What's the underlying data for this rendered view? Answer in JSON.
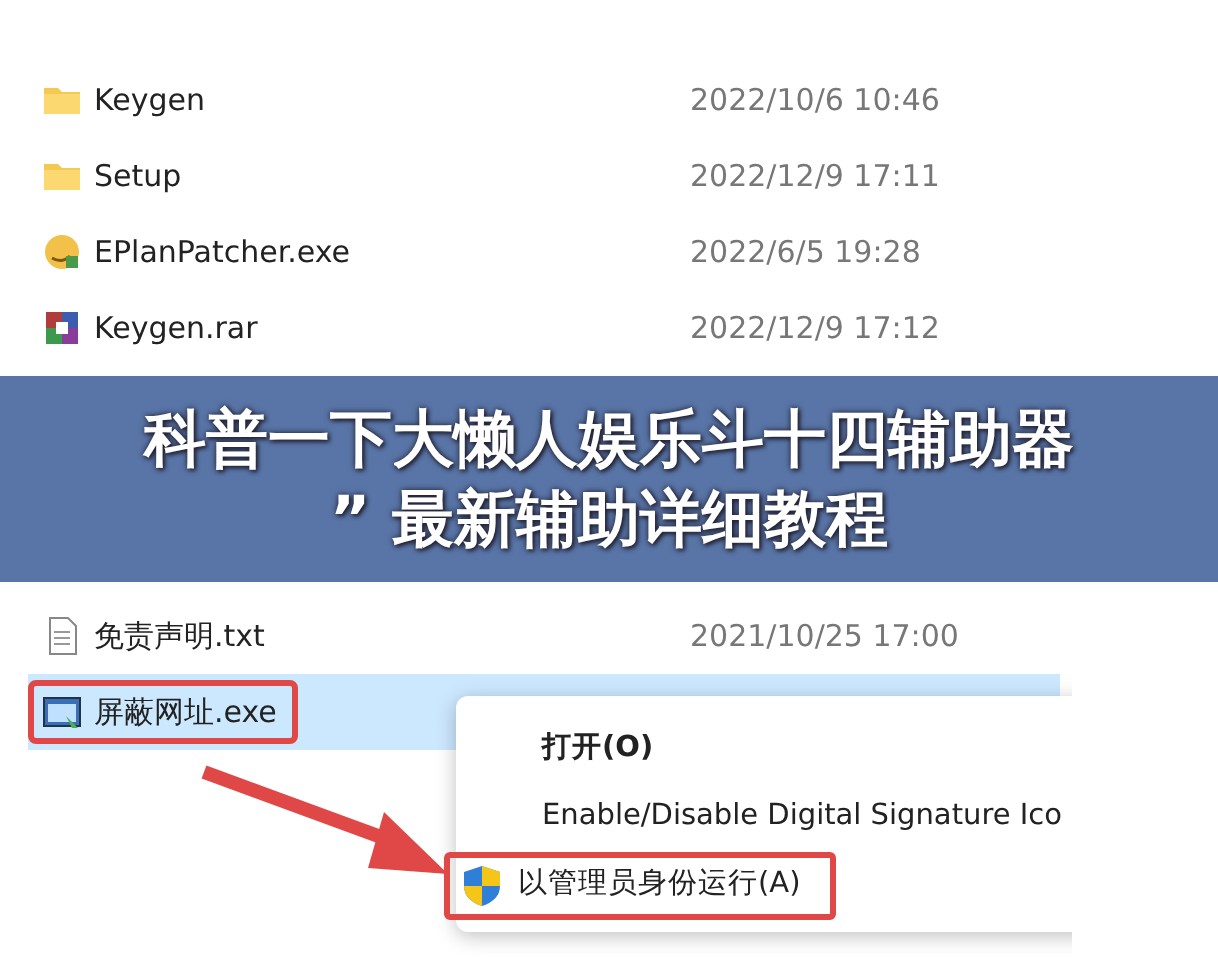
{
  "files": [
    {
      "name": "Keygen",
      "modified": "2022/10/6 10:46",
      "kind": "folder",
      "selected": false,
      "annotated": false
    },
    {
      "name": "Setup",
      "modified": "2022/12/9 17:11",
      "kind": "folder",
      "selected": false,
      "annotated": false
    },
    {
      "name": "EPlanPatcher.exe",
      "modified": "2022/6/5 19:28",
      "kind": "patcher",
      "selected": false,
      "annotated": false
    },
    {
      "name": "Keygen.rar",
      "modified": "2022/12/9 17:12",
      "kind": "archive",
      "selected": false,
      "annotated": false
    },
    {
      "name": "免责声明.txt",
      "modified": "2021/10/25 17:00",
      "kind": "text",
      "selected": false,
      "annotated": false
    },
    {
      "name": "屏蔽网址.exe",
      "kind": "program",
      "selected": true,
      "annotated": true
    }
  ],
  "banner": {
    "lines": [
      "科普一下大懒人娱乐斗十四辅助器",
      "” 最新辅助详细教程"
    ]
  },
  "context_menu": {
    "items": [
      {
        "label": "打开(O)",
        "bold": true,
        "shield": false,
        "annotated": false
      },
      {
        "label": "Enable/Disable Digital Signature Ico",
        "bold": false,
        "shield": false,
        "annotated": false
      },
      {
        "label": "以管理员身份运行(A)",
        "bold": false,
        "shield": true,
        "annotated": true
      }
    ]
  }
}
